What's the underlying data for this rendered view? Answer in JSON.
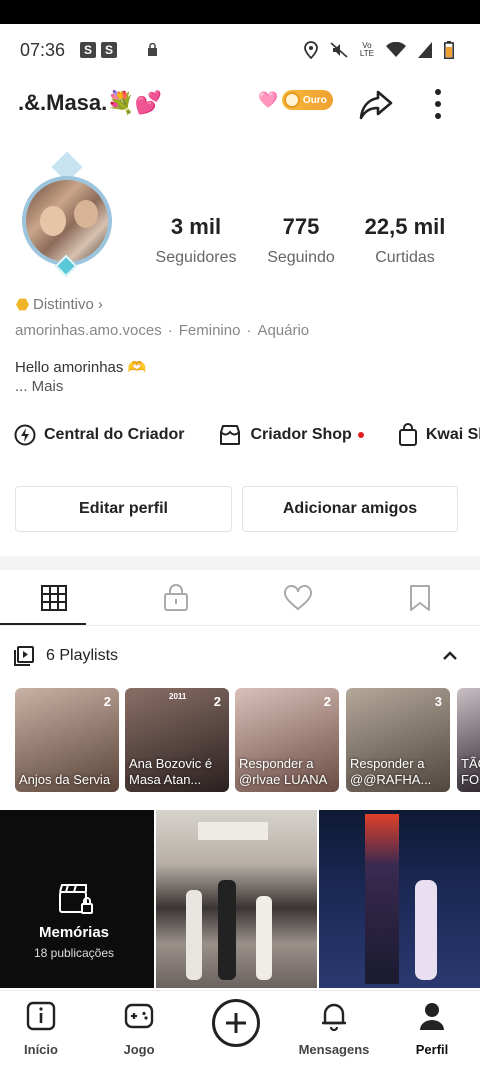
{
  "status_bar": {
    "time": "07:36",
    "notif_badges": [
      "S",
      "S"
    ],
    "volte": [
      "Vo",
      "LTE"
    ]
  },
  "header": {
    "username": ".&.Masa.💐💕",
    "badge_heart": "🩷",
    "badge_tier": "Ouro"
  },
  "stats": [
    {
      "value": "3 mil",
      "label": "Seguidores"
    },
    {
      "value": "775",
      "label": "Seguindo"
    },
    {
      "value": "22,5 mil",
      "label": "Curtidas"
    }
  ],
  "profile": {
    "badge_label": "Distintivo",
    "badge_chevron": "›",
    "handle": "amorinhas.amo.voces",
    "gender": "Feminino",
    "sign": "Aquário",
    "meta_sep": "·",
    "bio": "Hello amorinhas 🫶",
    "more": "... Mais"
  },
  "creator_links": [
    {
      "label": "Central do Criador",
      "icon": "lightning-circle-icon"
    },
    {
      "label": "Criador Shop",
      "icon": "shop-icon",
      "has_dot": true
    },
    {
      "label": "Kwai Sh",
      "icon": "bag-icon"
    }
  ],
  "actions": {
    "edit": "Editar perfil",
    "add_friends": "Adicionar amigos"
  },
  "tabs": [
    "grid-icon",
    "lock-icon",
    "heart-icon",
    "bookmark-icon"
  ],
  "playlists": {
    "header": "6 Playlists",
    "items": [
      {
        "title": "Anjos da Servia",
        "count": "2",
        "colors": [
          "#c9b2a4",
          "#5a4338"
        ]
      },
      {
        "title": "Ana Bozovic é Masa Atan...",
        "count": "2",
        "overlay": "2011",
        "colors": [
          "#8a6f66",
          "#2a2020"
        ]
      },
      {
        "title": "Responder a @rlvae LUANA",
        "count": "2",
        "colors": [
          "#d9c0b8",
          "#6a4c44"
        ]
      },
      {
        "title": "Responder a @@RAFHA...",
        "count": "3",
        "colors": [
          "#b4a89a",
          "#50463e"
        ]
      },
      {
        "title": "TÃO FO",
        "count": "",
        "colors": [
          "#c8c0c4",
          "#302830"
        ]
      }
    ]
  },
  "memories": {
    "title": "Memórias",
    "subtitle": "18 publicações"
  },
  "bottom_nav": [
    {
      "label": "Início",
      "icon": "home-icon"
    },
    {
      "label": "Jogo",
      "icon": "gamepad-icon"
    },
    {
      "label": "",
      "icon": "plus-icon"
    },
    {
      "label": "Mensagens",
      "icon": "bell-icon"
    },
    {
      "label": "Perfil",
      "icon": "person-icon"
    }
  ],
  "colors": {
    "accent_red": "#e02020",
    "gold": "#f0a030",
    "text": "#222222",
    "muted": "#888888"
  }
}
